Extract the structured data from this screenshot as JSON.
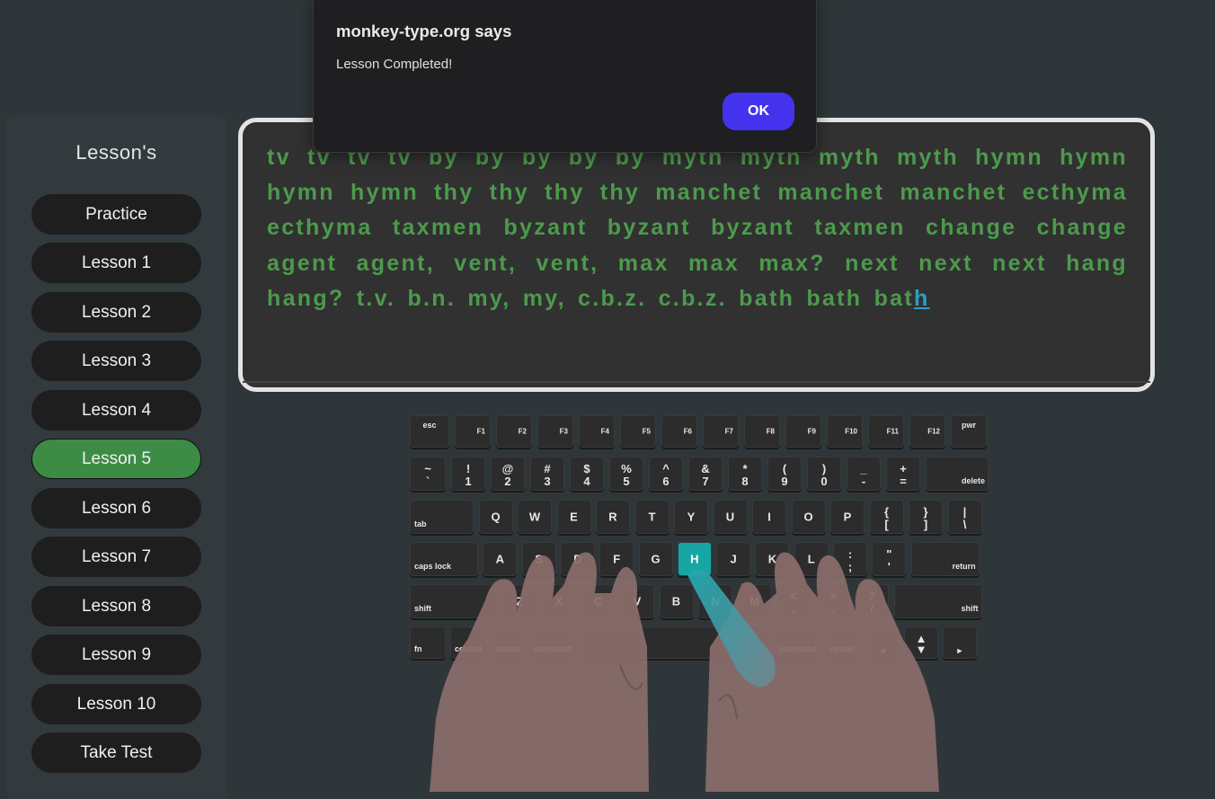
{
  "sidebar": {
    "title": "Lesson's",
    "items": [
      {
        "label": "Practice"
      },
      {
        "label": "Lesson 1"
      },
      {
        "label": "Lesson 2"
      },
      {
        "label": "Lesson 3"
      },
      {
        "label": "Lesson 4"
      },
      {
        "label": "Lesson 5",
        "active": true
      },
      {
        "label": "Lesson 6"
      },
      {
        "label": "Lesson 7"
      },
      {
        "label": "Lesson 8"
      },
      {
        "label": "Lesson 9"
      },
      {
        "label": "Lesson 10"
      },
      {
        "label": "Take Test"
      }
    ]
  },
  "typing": {
    "text_typed": "tv tv tv tv by by by by by myth myth myth myth hymn hymn hymn hymn thy thy thy thy manchet manchet manchet ecthyma ecthyma taxmen byzant byzant byzant taxmen change change agent agent, vent, vent, max max max? next next next hang hang? t.v. b.n. my, my, c.b.z. c.b.z. bath bath bat",
    "current_char": "h"
  },
  "keyboard": {
    "active_key": "H",
    "rows": [
      [
        "esc",
        "F1",
        "F2",
        "F3",
        "F4",
        "F5",
        "F6",
        "F7",
        "F8",
        "F9",
        "F10",
        "F11",
        "F12",
        "pwr"
      ],
      [
        [
          "~",
          "`"
        ],
        [
          "!",
          "1"
        ],
        [
          "@",
          "2"
        ],
        [
          "#",
          "3"
        ],
        [
          "$",
          "4"
        ],
        [
          "%",
          "5"
        ],
        [
          "^",
          "6"
        ],
        [
          "&",
          "7"
        ],
        [
          "*",
          "8"
        ],
        [
          "(",
          "9"
        ],
        [
          ")",
          "0"
        ],
        [
          "_",
          "-"
        ],
        [
          "+",
          "="
        ],
        "delete"
      ],
      [
        "tab",
        "Q",
        "W",
        "E",
        "R",
        "T",
        "Y",
        "U",
        "I",
        "O",
        "P",
        [
          "{",
          "["
        ],
        [
          "}",
          "]"
        ],
        [
          "|",
          "\\"
        ]
      ],
      [
        "caps lock",
        "A",
        "S",
        "D",
        "F",
        "G",
        "H",
        "J",
        "K",
        "L",
        [
          ":",
          ";"
        ],
        [
          "\"",
          "'"
        ],
        "return"
      ],
      [
        "shift",
        "Z",
        "X",
        "C",
        "V",
        "B",
        "N",
        "M",
        [
          "<",
          ","
        ],
        [
          ">",
          "."
        ],
        [
          "?",
          "/"
        ],
        "shift"
      ],
      [
        "fn",
        "control",
        "option",
        "command",
        "",
        "command",
        "option",
        "◄",
        [
          "▲",
          "▼"
        ],
        "►"
      ]
    ]
  },
  "dialog": {
    "title": "monkey-type.org says",
    "message": "Lesson Completed!",
    "ok_label": "OK"
  },
  "colors": {
    "background": "#2f3639",
    "text_correct": "#4d9a4c",
    "cursor": "#2d9ec4",
    "active_lesson": "#3c8c46",
    "active_key": "#16a6a4",
    "dialog_button": "#4433ee"
  }
}
